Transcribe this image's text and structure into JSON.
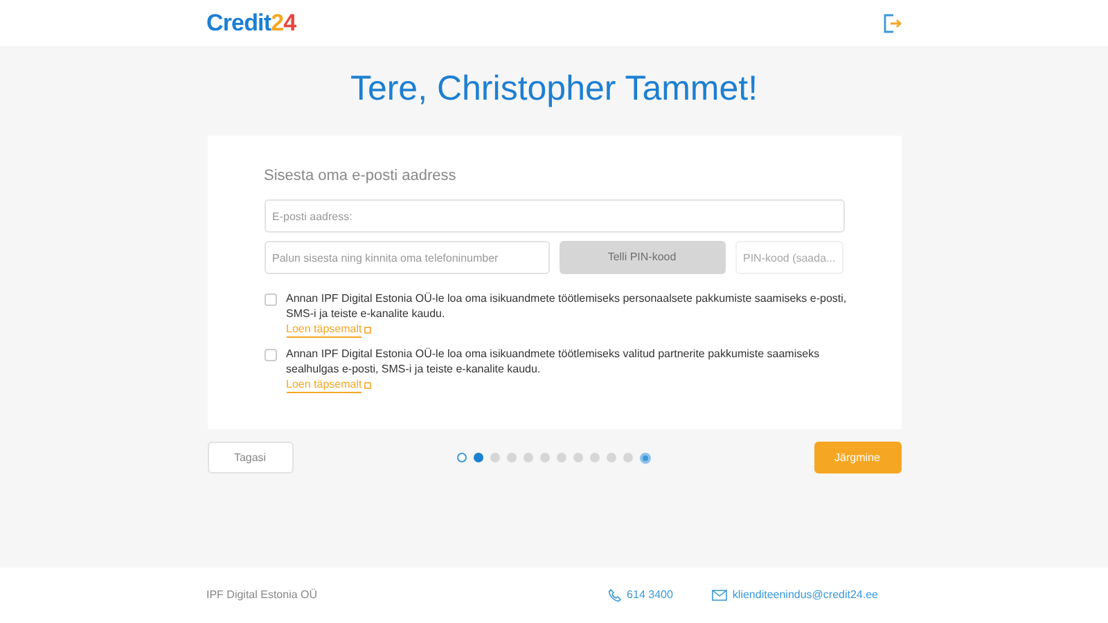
{
  "logo": {
    "parts": [
      "Credit",
      "2",
      "4"
    ]
  },
  "greeting": "Tere, Christopher Tammet!",
  "form": {
    "heading": "Sisesta oma e-posti aadress",
    "email_field": {
      "placeholder": "E-posti aadress:"
    },
    "phone_field": {
      "placeholder": "Palun sisesta ning kinnita oma telefoninumber"
    },
    "pin_button": {
      "label": "Telli PIN-kood",
      "disabled": true
    },
    "pin_field": {
      "placeholder": "PIN-kood (saada..."
    },
    "consents": [
      {
        "text": "Annan IPF Digital Estonia OÜ-le loa oma isikuandmete töötlemiseks personaalsete pakkumiste saamiseks e-posti, SMS-i ja teiste e-kanalite kaudu.",
        "checked": false,
        "link": "Loen täpsemalt"
      },
      {
        "text": "Annan IPF Digital Estonia OÜ-le loa oma isikuandmete töötlemiseks valitud partnerite pakkumiste saamiseks sealhulgas e-posti, SMS-i ja teiste e-kanalite kaudu.",
        "checked": false,
        "link": "Loen täpsemalt"
      }
    ]
  },
  "back_button": "Tagasi",
  "steps": [
    {
      "kind": "done"
    },
    {
      "kind": "current"
    },
    {
      "kind": "todo"
    },
    {
      "kind": "todo"
    },
    {
      "kind": "todo"
    },
    {
      "kind": "todo"
    },
    {
      "kind": "todo"
    },
    {
      "kind": "todo"
    },
    {
      "kind": "todo"
    },
    {
      "kind": "todo"
    },
    {
      "kind": "todo"
    },
    {
      "kind": "final"
    }
  ],
  "next_button": "Järgmine",
  "footer": {
    "company": "IPF Digital Estonia OÜ",
    "phone": "614 3400",
    "email": "klienditeenindus@credit24.ee"
  }
}
